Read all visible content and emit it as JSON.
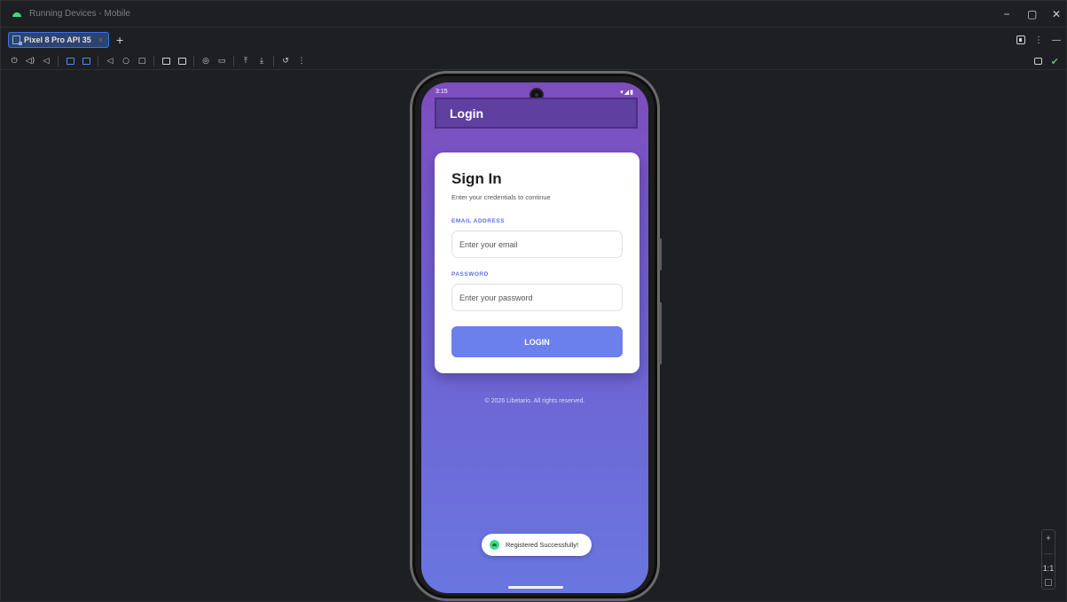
{
  "window": {
    "title": "Running Devices - Mobile",
    "controls": {
      "minimize": "−",
      "restore": "▢",
      "close": "✕"
    }
  },
  "tabs": [
    {
      "label": "Pixel 8 Pro API 35",
      "close": "×"
    }
  ],
  "tabbar": {
    "add": "+",
    "more": "⋮",
    "hide": "—"
  },
  "toolbar": {
    "icons": [
      "power-icon",
      "volume-up-icon",
      "volume-down-icon",
      "rotate-left-icon",
      "rotate-right-icon",
      "back-icon",
      "home-icon",
      "overview-icon",
      "snapshot-icon",
      "fold-icon",
      "screenshot-icon",
      "screen-record-icon",
      "push-icon",
      "pull-icon",
      "reset-icon",
      "more-icon"
    ],
    "more": "⋮"
  },
  "toolbar_right": {
    "check": "✔"
  },
  "phone": {
    "status": {
      "time": "3:15",
      "right": "▾◢▮"
    },
    "appbar_title": "Login",
    "card": {
      "title": "Sign In",
      "subtitle": "Enter your credentials to continue",
      "email_label": "EMAIL ADDRESS",
      "email_placeholder": "Enter your email",
      "password_label": "PASSWORD",
      "password_placeholder": "Enter your password",
      "login_label": "LOGIN"
    },
    "footer": "© 2026 Libetario. All rights reserved.",
    "toast": "Registered Successfully!"
  },
  "zoom": {
    "in": "+",
    "out": "—",
    "actual": "1:1"
  },
  "colors": {
    "accent": "#3574f0",
    "gradient_top": "#7e4dbd",
    "gradient_bottom": "#6a76e0",
    "appbar": "#5f3fa0",
    "button": "#6b80ea",
    "label": "#5a73e8"
  }
}
